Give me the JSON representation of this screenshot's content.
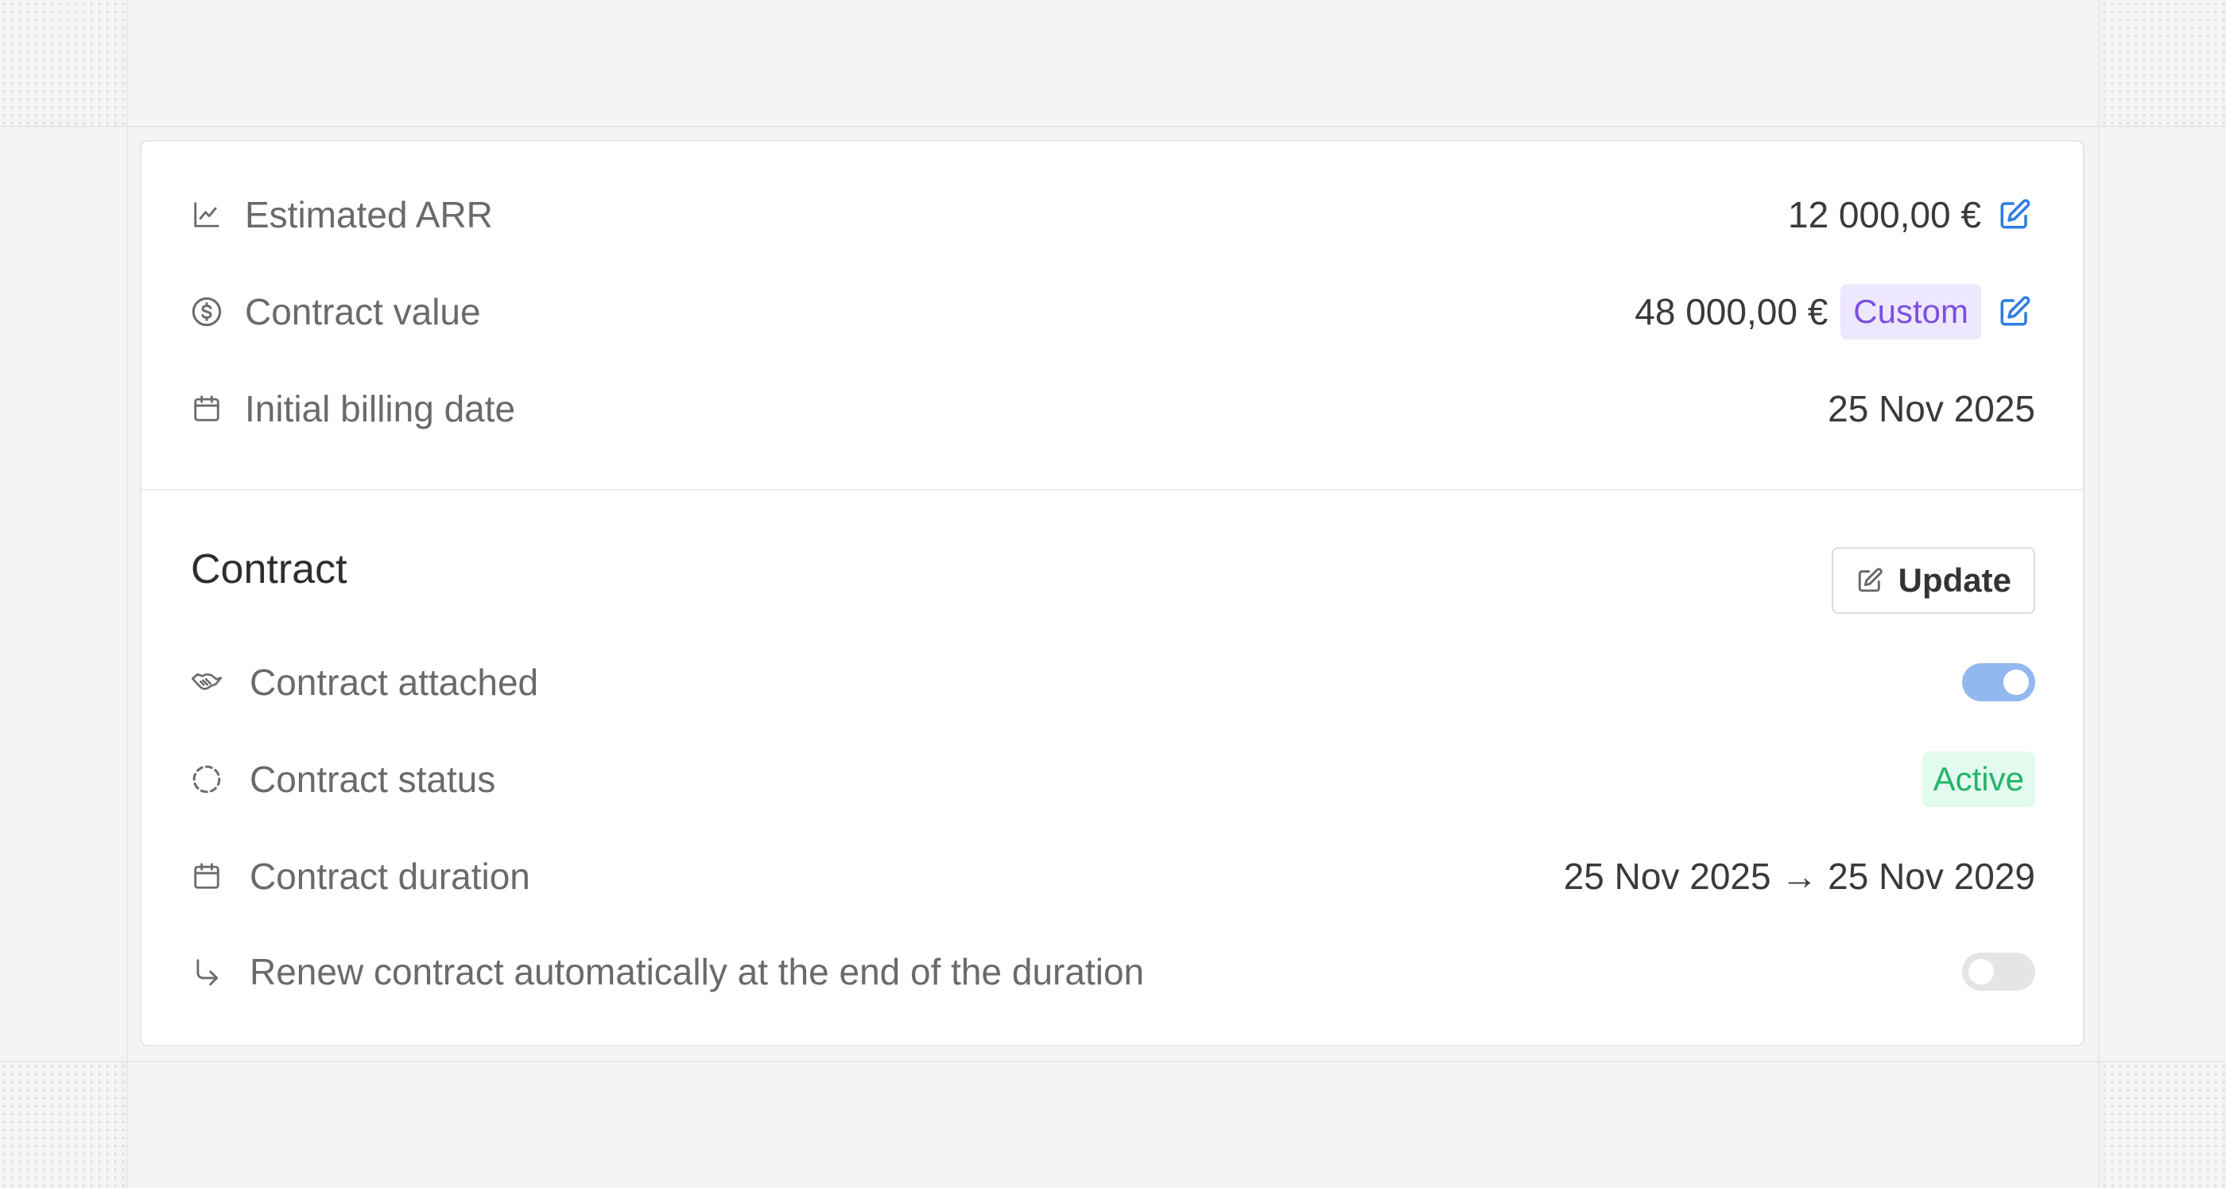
{
  "metrics": {
    "estimated_arr": {
      "label": "Estimated ARR",
      "value": "12 000,00 €",
      "icon": "chart-line-icon"
    },
    "contract_value": {
      "label": "Contract value",
      "value": "48 000,00 €",
      "badge": "Custom",
      "icon": "dollar-circle-icon"
    },
    "initial_billing_date": {
      "label": "Initial billing date",
      "value": "25 Nov 2025",
      "icon": "calendar-icon"
    }
  },
  "contract": {
    "title": "Contract",
    "update_label": "Update",
    "attached": {
      "label": "Contract attached",
      "enabled": true,
      "icon": "handshake-icon"
    },
    "status": {
      "label": "Contract status",
      "value": "Active",
      "icon": "dashed-circle-icon"
    },
    "duration": {
      "label": "Contract duration",
      "value": "25 Nov 2025 → 25 Nov 2029",
      "icon": "calendar-icon"
    },
    "auto_renew": {
      "label": "Renew contract automatically at the end of the duration",
      "enabled": false,
      "icon": "corner-down-right-icon"
    }
  },
  "colors": {
    "accent": "#2f7de1",
    "custom_badge_bg": "#ede8fd",
    "custom_badge_text": "#7c4fe0",
    "active_badge_bg": "#e3fbee",
    "active_badge_text": "#24b46a",
    "toggle_on": "#93b8f0"
  }
}
